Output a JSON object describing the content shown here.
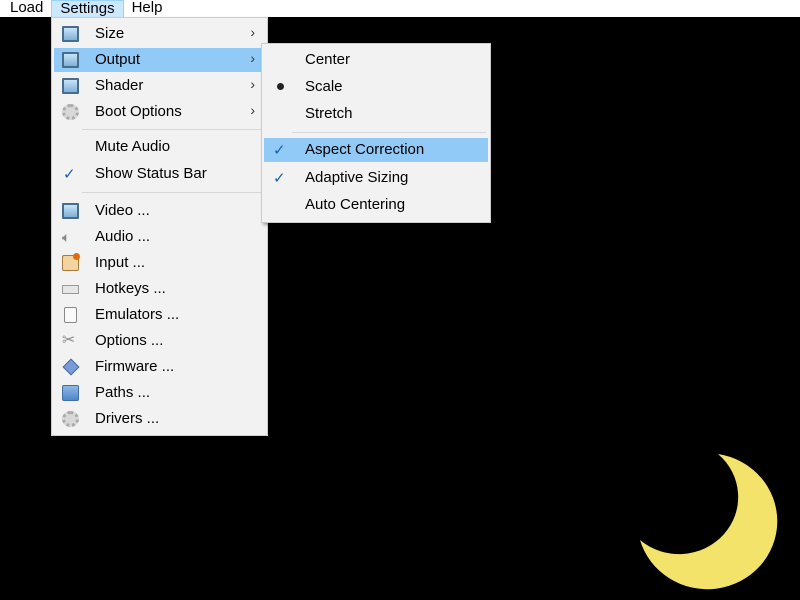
{
  "menubar": {
    "items": [
      {
        "label": "Load"
      },
      {
        "label": "Settings",
        "open": true
      },
      {
        "label": "Help"
      }
    ]
  },
  "settings_menu": {
    "items": [
      {
        "label": "Size",
        "icon": "monitor-icon",
        "submenu": true
      },
      {
        "label": "Output",
        "icon": "monitor-icon",
        "submenu": true,
        "highlighted": true
      },
      {
        "label": "Shader",
        "icon": "monitor-icon",
        "submenu": true
      },
      {
        "label": "Boot Options",
        "icon": "gear-icon",
        "submenu": true
      },
      {
        "label": "Mute Audio",
        "checked": false
      },
      {
        "label": "Show Status Bar",
        "checked": true
      },
      {
        "label": "Video ...",
        "icon": "monitor-icon"
      },
      {
        "label": "Audio ...",
        "icon": "speaker-icon"
      },
      {
        "label": "Input ...",
        "icon": "input-icon"
      },
      {
        "label": "Hotkeys ...",
        "icon": "keyboard-icon"
      },
      {
        "label": "Emulators ...",
        "icon": "emulator-icon"
      },
      {
        "label": "Options ...",
        "icon": "tools-icon"
      },
      {
        "label": "Firmware ...",
        "icon": "chip-icon"
      },
      {
        "label": "Paths ...",
        "icon": "folder-icon"
      },
      {
        "label": "Drivers ...",
        "icon": "gear-icon"
      }
    ]
  },
  "output_menu": {
    "items": [
      {
        "label": "Center",
        "selected": false
      },
      {
        "label": "Scale",
        "selected": true
      },
      {
        "label": "Stretch",
        "selected": false
      },
      {
        "label": "Aspect Correction",
        "checked": true,
        "highlighted": true
      },
      {
        "label": "Adaptive Sizing",
        "checked": true
      },
      {
        "label": "Auto Centering",
        "checked": false
      }
    ]
  },
  "colors": {
    "menu_highlight": "#91c9f7",
    "menubar_open": "#cce8ff",
    "moon": "#f4e36a",
    "background": "#000000"
  }
}
